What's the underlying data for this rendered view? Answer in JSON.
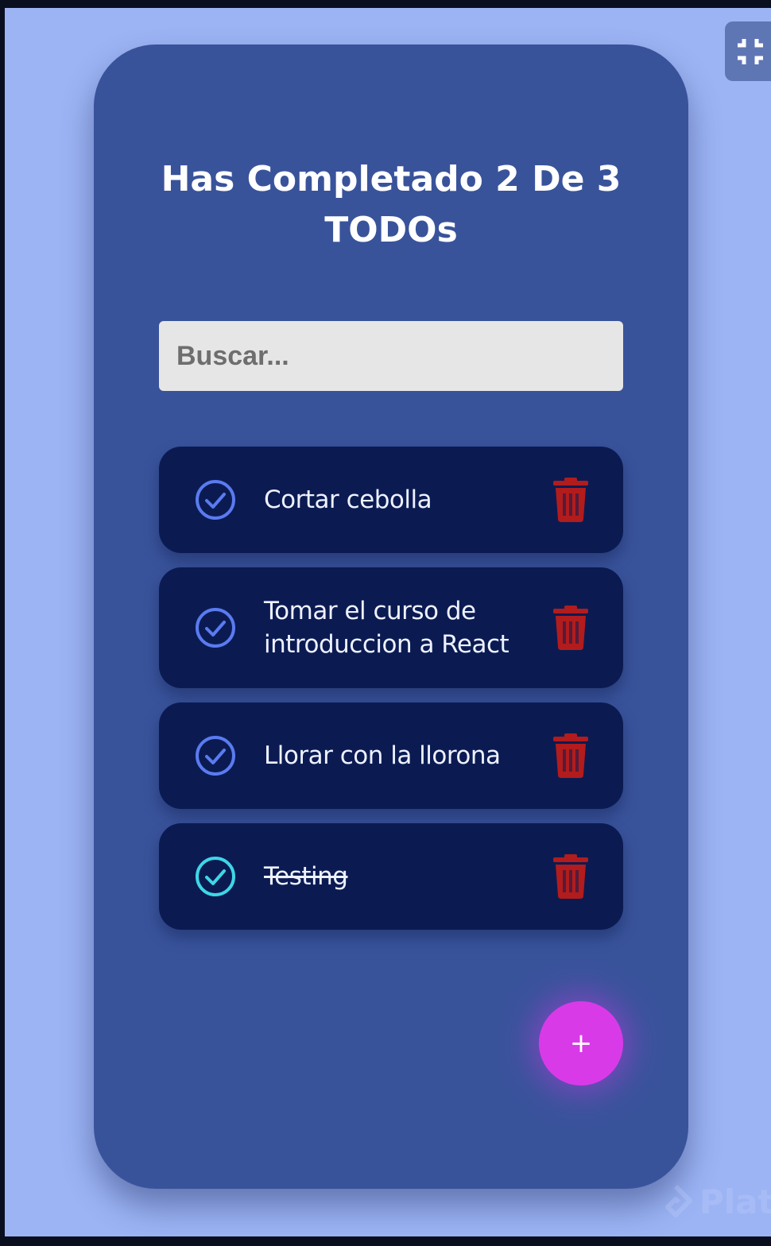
{
  "header": {
    "title": "Has Completado 2 De 3 TODOs"
  },
  "search": {
    "placeholder": "Buscar..."
  },
  "todos": [
    {
      "text": "Cortar cebolla",
      "completed": false
    },
    {
      "text": "Tomar el curso de introduccion a React",
      "completed": false
    },
    {
      "text": "Llorar con la llorona",
      "completed": false
    },
    {
      "text": "Testing",
      "completed": true
    }
  ],
  "fab": {
    "label": "+"
  },
  "colors": {
    "page_background": "#9cb4f4",
    "card": "#39539b",
    "item": "#0b1b52",
    "check_default": "#5a7bf0",
    "check_completed": "#3fd6e6",
    "delete": "#b21c1c",
    "fab": "#d93ae8"
  },
  "icons": {
    "check": "check-circle-icon",
    "delete": "trash-icon",
    "exit_fullscreen": "exit-fullscreen-icon"
  }
}
